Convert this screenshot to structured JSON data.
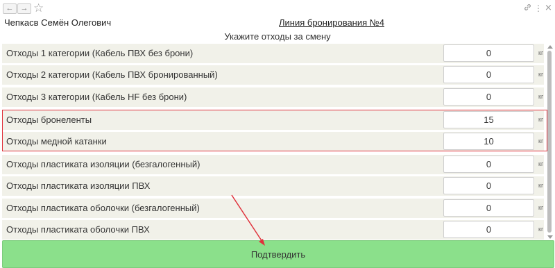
{
  "window": {
    "back_icon": "←",
    "forward_icon": "→",
    "favorite_icon": "☆",
    "link_icon": "🔗",
    "menu_icon": "⋮",
    "close_icon": "×"
  },
  "header": {
    "user_name": "Чепкасв Семён Олегович",
    "line_title": "Линия бронирования №4",
    "subtitle": "Укажите отходы за смену"
  },
  "rows": [
    {
      "label": "Отходы 1 категории (Кабель ПВХ без брони)",
      "value": "0",
      "unit": "кг"
    },
    {
      "label": "Отходы 2 категории (Кабель ПВХ бронированный)",
      "value": "0",
      "unit": "кг"
    },
    {
      "label": "Отходы 3 категории (Кабель HF без брони)",
      "value": "0",
      "unit": "кг"
    },
    {
      "label": "Отходы бронеленты",
      "value": "15",
      "unit": "кг"
    },
    {
      "label": "Отходы медной катанки",
      "value": "10",
      "unit": "кг"
    },
    {
      "label": "Отходы пластиката изоляции (безгалогенный)",
      "value": "0",
      "unit": "кг"
    },
    {
      "label": "Отходы пластиката изоляции ПВХ",
      "value": "0",
      "unit": "кг"
    },
    {
      "label": "Отходы пластиката оболочки (безгалогенный)",
      "value": "0",
      "unit": "кг"
    },
    {
      "label": "Отходы пластиката оболочки ПВХ",
      "value": "0",
      "unit": "кг"
    }
  ],
  "confirm_label": "Подтвердить",
  "colors": {
    "row_background": "#f1f1e9",
    "confirm_button": "#8be08b",
    "highlight_border": "#e0313b"
  }
}
